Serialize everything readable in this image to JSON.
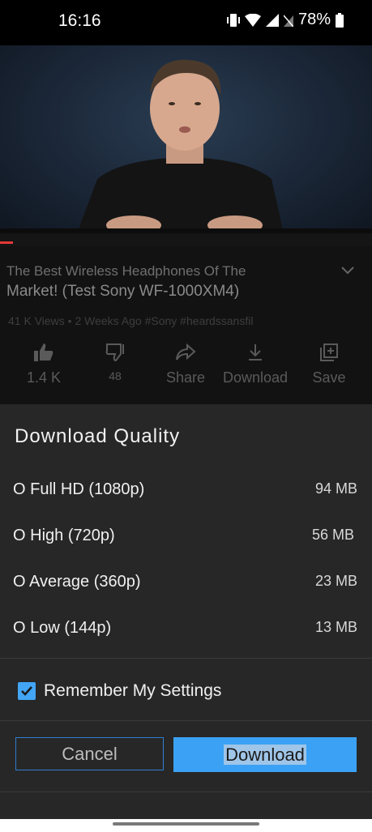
{
  "status": {
    "time": "16:16",
    "battery": "78%",
    "icons": [
      "vibrate-icon",
      "wifi-icon",
      "signal-icon",
      "no-sim-icon",
      "battery-icon"
    ]
  },
  "video": {
    "title_line1": "The Best Wireless Headphones Of The",
    "title_line2": "Market! (Test Sony WF-1000XM4)",
    "meta": "41 K Views • 2 Weeks Ago #Sony #heardssansfil"
  },
  "actions": {
    "like_count": "1.4 K",
    "dislike_count": "48",
    "share_label": "Share",
    "download_label": "Download",
    "save_label": "Save"
  },
  "dialog": {
    "title": "Download Quality",
    "options": [
      {
        "radio": "O",
        "label": "Full HD (1080p)",
        "size": "94 MB"
      },
      {
        "radio": "O",
        "label": "High (720p)",
        "size": "56 MB"
      },
      {
        "radio": "O",
        "label": "Average (360p)",
        "size": "23 MB"
      },
      {
        "radio": "O",
        "label": "Low (144p)",
        "size": "13 MB"
      }
    ],
    "remember_label": "Remember My Settings",
    "remember_checked": true,
    "cancel_label": "Cancel",
    "download_label": "Download",
    "accent_color": "#3ba1f4"
  }
}
